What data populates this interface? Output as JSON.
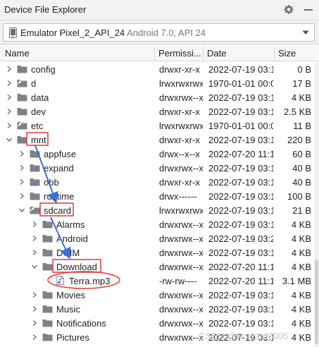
{
  "window": {
    "title": "Device File Explorer"
  },
  "device": {
    "name": "Emulator Pixel_2_API_24",
    "info": "Android 7.0, API 24"
  },
  "columns": {
    "name": "Name",
    "permissions": "Permissi...",
    "date": "Date",
    "size": "Size"
  },
  "rows": [
    {
      "name": "config",
      "perm": "drwxr-xr-x",
      "date": "2022-07-19 03:1",
      "size": "0 B",
      "depth": 0,
      "expanded": false,
      "kind": "folder"
    },
    {
      "name": "d",
      "perm": "lrwxrwxrwx",
      "date": "1970-01-01 00:0",
      "size": "17 B",
      "depth": 0,
      "expanded": false,
      "kind": "link"
    },
    {
      "name": "data",
      "perm": "drwxrwx--x",
      "date": "2022-07-19 03:1",
      "size": "4 KB",
      "depth": 0,
      "expanded": false,
      "kind": "folder"
    },
    {
      "name": "dev",
      "perm": "drwxr-xr-x",
      "date": "2022-07-19 03:1",
      "size": "2.5 KB",
      "depth": 0,
      "expanded": false,
      "kind": "folder"
    },
    {
      "name": "etc",
      "perm": "lrwxrwxrwx",
      "date": "1970-01-01 00:0",
      "size": "11 B",
      "depth": 0,
      "expanded": false,
      "kind": "link"
    },
    {
      "name": "mnt",
      "perm": "drwxr-xr-x",
      "date": "2022-07-19 03:1",
      "size": "220 B",
      "depth": 0,
      "expanded": true,
      "kind": "folder"
    },
    {
      "name": "appfuse",
      "perm": "drwx--x--x",
      "date": "2022-07-20 11:1",
      "size": "60 B",
      "depth": 1,
      "expanded": false,
      "kind": "folder"
    },
    {
      "name": "expand",
      "perm": "drwxrwx--x",
      "date": "2022-07-19 03:1",
      "size": "40 B",
      "depth": 1,
      "expanded": false,
      "kind": "folder"
    },
    {
      "name": "obb",
      "perm": "drwxr-xr-x",
      "date": "2022-07-19 03:1",
      "size": "40 B",
      "depth": 1,
      "expanded": false,
      "kind": "folder"
    },
    {
      "name": "runtime",
      "perm": "drwx------",
      "date": "2022-07-19 03:1",
      "size": "100 B",
      "depth": 1,
      "expanded": false,
      "kind": "folder"
    },
    {
      "name": "sdcard",
      "perm": "lrwxrwxrwx",
      "date": "2022-07-19 03:1",
      "size": "21 B",
      "depth": 1,
      "expanded": true,
      "kind": "link"
    },
    {
      "name": "Alarms",
      "perm": "drwxrwx--x",
      "date": "2022-07-19 03:1",
      "size": "4 KB",
      "depth": 2,
      "expanded": false,
      "kind": "folder"
    },
    {
      "name": "Android",
      "perm": "drwxrwx--x",
      "date": "2022-07-19 03:2",
      "size": "4 KB",
      "depth": 2,
      "expanded": false,
      "kind": "folder"
    },
    {
      "name": "DCIM",
      "perm": "drwxrwx--x",
      "date": "2022-07-19 03:1",
      "size": "4 KB",
      "depth": 2,
      "expanded": false,
      "kind": "folder"
    },
    {
      "name": "Download",
      "perm": "drwxrwx--x",
      "date": "2022-07-20 11:1",
      "size": "4 KB",
      "depth": 2,
      "expanded": true,
      "kind": "folder"
    },
    {
      "name": "Terra.mp3",
      "perm": "-rw-rw----",
      "date": "2022-07-20 11:1",
      "size": "3.1 MB",
      "depth": 3,
      "expanded": false,
      "kind": "file"
    },
    {
      "name": "Movies",
      "perm": "drwxrwx--x",
      "date": "2022-07-19 03:1",
      "size": "4 KB",
      "depth": 2,
      "expanded": false,
      "kind": "folder"
    },
    {
      "name": "Music",
      "perm": "drwxrwx--x",
      "date": "2022-07-19 03:1",
      "size": "4 KB",
      "depth": 2,
      "expanded": false,
      "kind": "folder"
    },
    {
      "name": "Notifications",
      "perm": "drwxrwx--x",
      "date": "2022-07-19 03:1",
      "size": "4 KB",
      "depth": 2,
      "expanded": false,
      "kind": "folder"
    },
    {
      "name": "Pictures",
      "perm": "drwxrwx--x",
      "date": "2022-07-19 03:1",
      "size": "4 KB",
      "depth": 2,
      "expanded": false,
      "kind": "folder"
    }
  ],
  "watermark": "CSDN @Howard2005",
  "colors": {
    "annotation_red": "#e53935",
    "annotation_blue": "#3b6fd8",
    "folder_gray": "#7d8289"
  }
}
